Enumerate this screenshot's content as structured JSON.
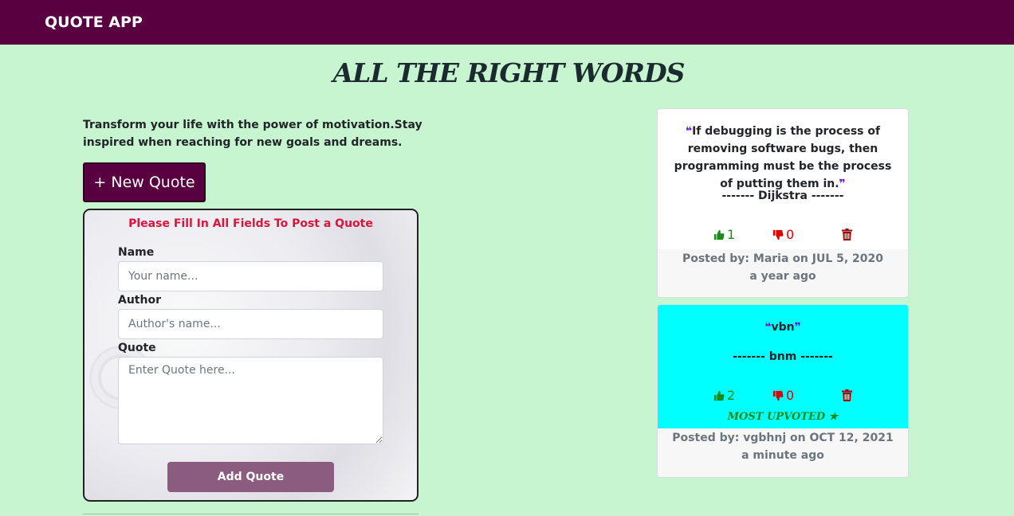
{
  "navbar": {
    "brand": "QUOTE APP"
  },
  "page": {
    "title": "ALL THE RIGHT WORDS",
    "tagline": "Transform your life with the power of motivation.Stay inspired when reaching for new goals and dreams."
  },
  "new_quote_button": {
    "label": "+ New Quote"
  },
  "form": {
    "warning": "Please Fill In All Fields To Post a Quote",
    "name_label": "Name",
    "name_placeholder": "Your name...",
    "author_label": "Author",
    "author_placeholder": "Author's name...",
    "quote_label": "Quote",
    "quote_placeholder": "Enter Quote here...",
    "submit_label": "Add Quote"
  },
  "quotes": [
    {
      "text": "If debugging is the process of removing software bugs, then programming must be the process of putting them in.",
      "author": "------- Dijkstra -------",
      "upvotes": "1",
      "downvotes": "0",
      "posted_by": "Posted by: Maria on JUL 5, 2020",
      "ago": "a year ago",
      "highlight": false,
      "background": "#ffffff"
    },
    {
      "text": "vbn",
      "author": "------- bnm -------",
      "upvotes": "2",
      "downvotes": "0",
      "posted_by": "Posted by: vgbhnj on OCT 12, 2021",
      "ago": "a minute ago",
      "highlight": true,
      "badge": "MOST UPVOTED",
      "background": "#00ffff"
    }
  ],
  "colors": {
    "navbar": "#580040",
    "page_background": "#c6f5d0",
    "upvote": "#1a8a1a",
    "downvote": "#dd0000",
    "trash": "#a00000",
    "quote_mark": "#6b12e8",
    "warning": "#dc143c",
    "submit_button": "#8c5b80"
  },
  "icons": {
    "upvote": "thumbs-up-icon",
    "downvote": "thumbs-down-icon",
    "delete": "trash-icon",
    "open_quote": "quote-left-icon",
    "close_quote": "quote-right-icon",
    "badge": "star-icon"
  }
}
